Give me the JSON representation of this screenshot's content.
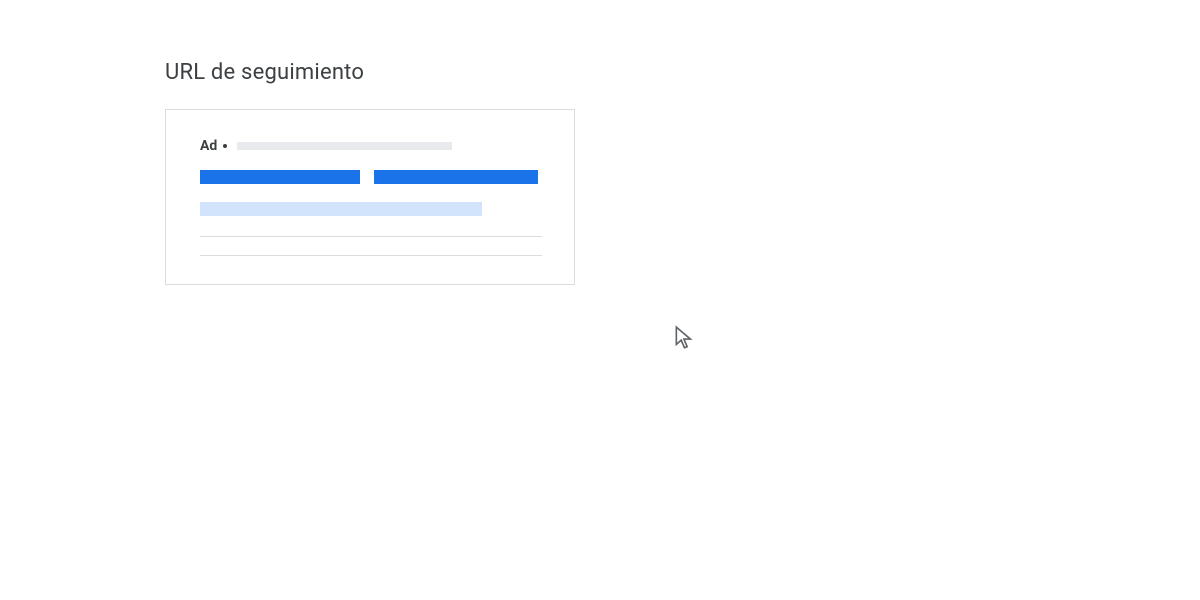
{
  "section": {
    "title": "URL de seguimiento"
  },
  "adPreview": {
    "label": "Ad"
  }
}
